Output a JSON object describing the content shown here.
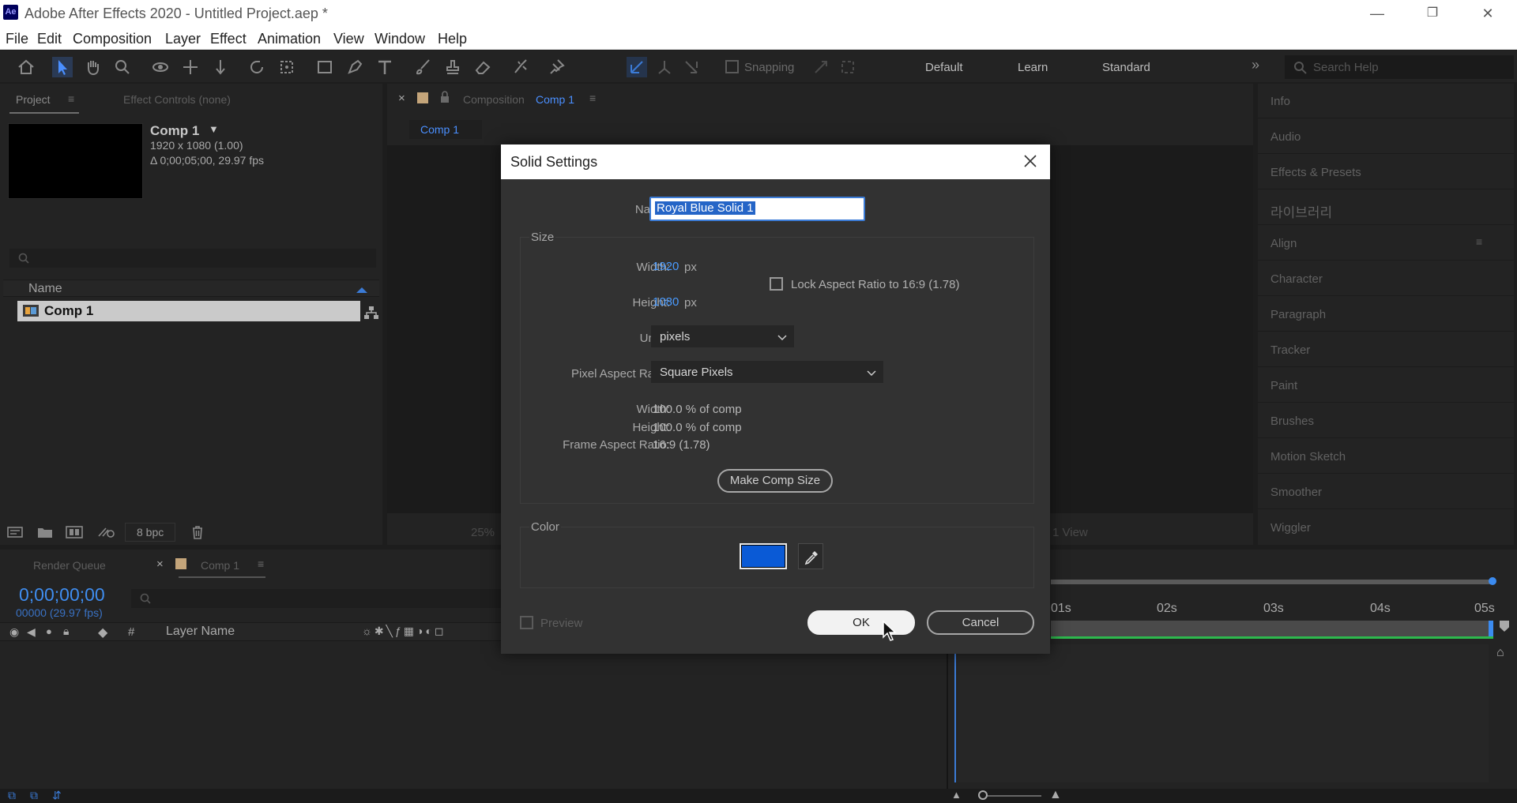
{
  "titlebar": {
    "app_badge": "Ae",
    "title": "Adobe After Effects 2020 - Untitled Project.aep *",
    "minimize": "—",
    "restore": "❐",
    "close": "✕"
  },
  "menu": [
    "File",
    "Edit",
    "Composition",
    "Layer",
    "Effect",
    "Animation",
    "View",
    "Window",
    "Help"
  ],
  "toolbar": {
    "snapping_label": "Snapping",
    "workspaces": [
      "Default",
      "Learn",
      "Standard"
    ],
    "search_placeholder": "Search Help"
  },
  "project_panel": {
    "tab_project": "Project",
    "tab_effect_controls": "Effect Controls  (none)",
    "comp_name": "Comp 1",
    "comp_size": "1920 x 1080 (1.00)",
    "comp_duration": "Δ 0;00;05;00, 29.97 fps",
    "column_name": "Name",
    "items": [
      {
        "name": "Comp 1"
      }
    ],
    "bpc": "8 bpc"
  },
  "comp_panel": {
    "tab_prefix": "Composition",
    "tab_name": "Comp 1",
    "sub_tab": "Comp 1",
    "zoom": "25%",
    "view": "1 View"
  },
  "right_panel": {
    "items": [
      "Info",
      "Audio",
      "Effects & Presets",
      "라이브러리",
      "Align",
      "Character",
      "Paragraph",
      "Tracker",
      "Paint",
      "Brushes",
      "Motion Sketch",
      "Smoother",
      "Wiggler"
    ]
  },
  "timeline": {
    "tab_render_queue": "Render Queue",
    "tab_comp": "Comp 1",
    "timecode": "0;00;00;00",
    "frames": "00000 (29.97 fps)",
    "col_hash": "#",
    "col_layer_name": "Layer Name",
    "ruler": [
      "01s",
      "02s",
      "03s",
      "04s",
      "05s"
    ]
  },
  "dialog": {
    "title": "Solid Settings",
    "name_label": "Name:",
    "name_value": "Royal Blue Solid 1",
    "size_group": "Size",
    "width_label": "Width:",
    "width_value": "1920",
    "height_label": "Height:",
    "height_value": "1080",
    "px": "px",
    "lock_label": "Lock Aspect Ratio to 16:9 (1.78)",
    "units_label": "Units:",
    "units_value": "pixels",
    "par_label": "Pixel Aspect Ratio:",
    "par_value": "Square Pixels",
    "pct_width_label": "Width:",
    "pct_width_value": "100.0 % of comp",
    "pct_height_label": "Height:",
    "pct_height_value": "100.0 % of comp",
    "far_label": "Frame Aspect Ratio:",
    "far_value": "16:9 (1.78)",
    "make_comp_size": "Make Comp Size",
    "color_group": "Color",
    "color_hex": "#0a5ad6",
    "preview_label": "Preview",
    "ok": "OK",
    "cancel": "Cancel"
  }
}
